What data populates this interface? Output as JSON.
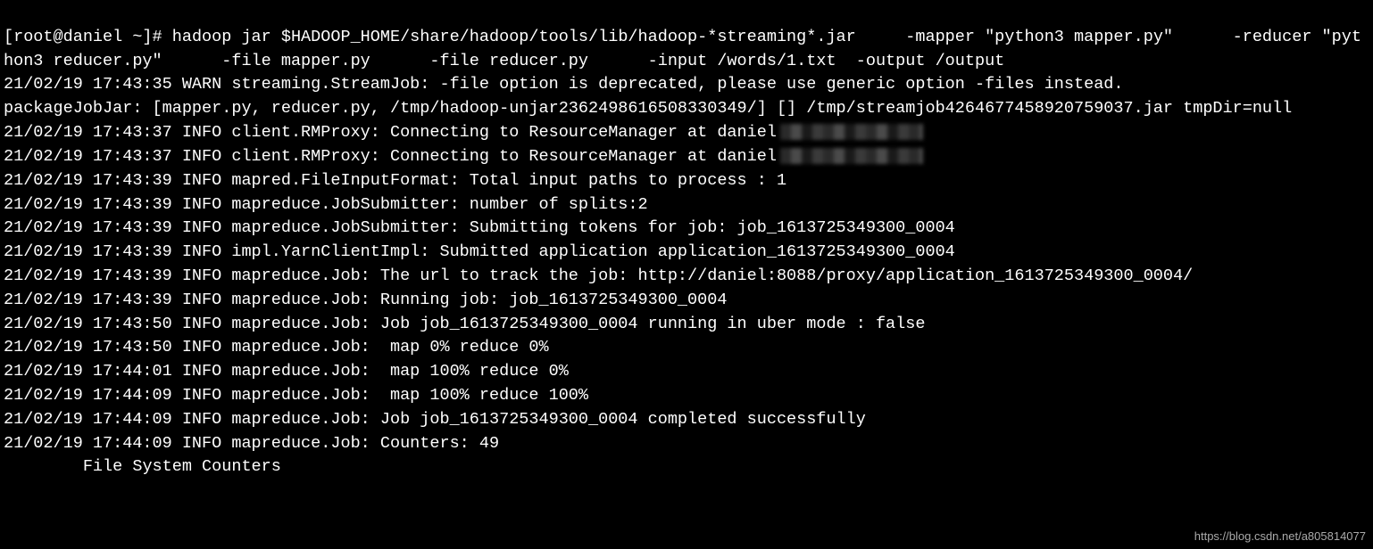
{
  "cmd": {
    "prompt": "[root@daniel ~]# ",
    "command": "hadoop jar $HADOOP_HOME/share/hadoop/tools/lib/hadoop-*streaming*.jar     -mapper \"python3 mapper.py\"      -reducer \"python3 reducer.py\"      -file mapper.py      -file reducer.py      -input /words/1.txt  -output /output"
  },
  "lines": [
    "21/02/19 17:43:35 WARN streaming.StreamJob: -file option is deprecated, please use generic option -files instead.",
    "packageJobJar: [mapper.py, reducer.py, /tmp/hadoop-unjar2362498616508330349/] [] /tmp/streamjob4264677458920759037.jar tmpDir=null",
    "21/02/19 17:43:37 INFO client.RMProxy: Connecting to ResourceManager at daniel",
    "21/02/19 17:43:37 INFO client.RMProxy: Connecting to ResourceManager at daniel",
    "21/02/19 17:43:39 INFO mapred.FileInputFormat: Total input paths to process : 1",
    "21/02/19 17:43:39 INFO mapreduce.JobSubmitter: number of splits:2",
    "21/02/19 17:43:39 INFO mapreduce.JobSubmitter: Submitting tokens for job: job_1613725349300_0004",
    "21/02/19 17:43:39 INFO impl.YarnClientImpl: Submitted application application_1613725349300_0004",
    "21/02/19 17:43:39 INFO mapreduce.Job: The url to track the job: http://daniel:8088/proxy/application_1613725349300_0004/",
    "21/02/19 17:43:39 INFO mapreduce.Job: Running job: job_1613725349300_0004",
    "21/02/19 17:43:50 INFO mapreduce.Job: Job job_1613725349300_0004 running in uber mode : false",
    "21/02/19 17:43:50 INFO mapreduce.Job:  map 0% reduce 0%",
    "21/02/19 17:44:01 INFO mapreduce.Job:  map 100% reduce 0%",
    "21/02/19 17:44:09 INFO mapreduce.Job:  map 100% reduce 100%",
    "21/02/19 17:44:09 INFO mapreduce.Job: Job job_1613725349300_0004 completed successfully",
    "21/02/19 17:44:09 INFO mapreduce.Job: Counters: 49",
    "        File System Counters"
  ],
  "redacted_line_indices": [
    2,
    3
  ],
  "watermark": "https://blog.csdn.net/a805814077"
}
